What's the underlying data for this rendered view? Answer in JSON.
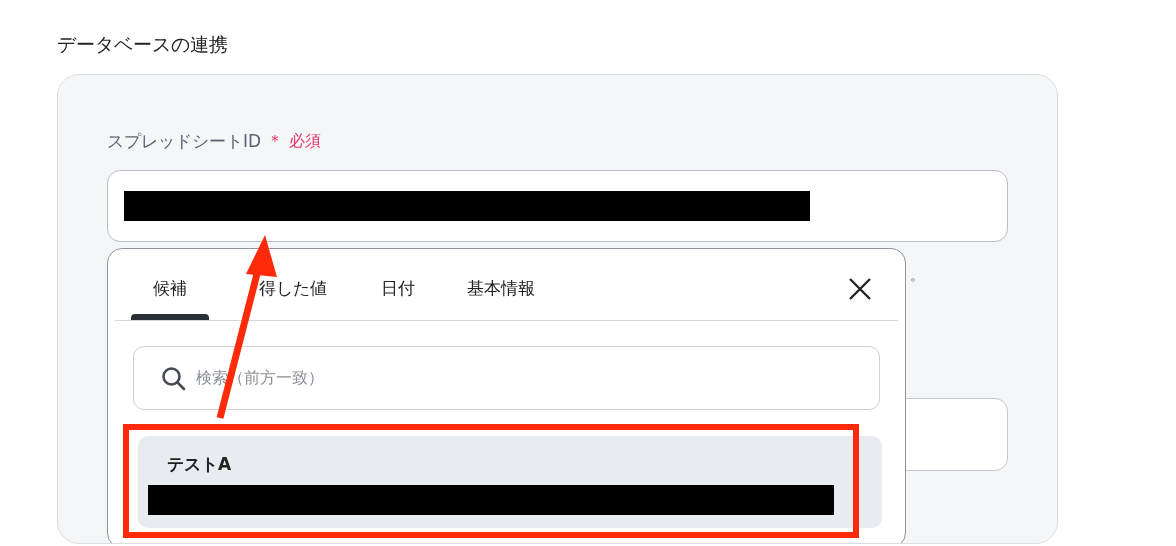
{
  "section_title": "データベースの連携",
  "field": {
    "label": "スプレッドシートID",
    "required_mark": "＊",
    "required_text": "必須"
  },
  "hint_fragment": "。",
  "popup": {
    "tabs": [
      {
        "label": "候補",
        "selected": true
      },
      {
        "label": "得した値",
        "selected": false
      },
      {
        "label": "日付",
        "selected": false
      },
      {
        "label": "基本情報",
        "selected": false
      }
    ],
    "search": {
      "placeholder": "検索（前方一致）"
    },
    "items": [
      {
        "title": "テストA",
        "selected": true
      }
    ]
  }
}
